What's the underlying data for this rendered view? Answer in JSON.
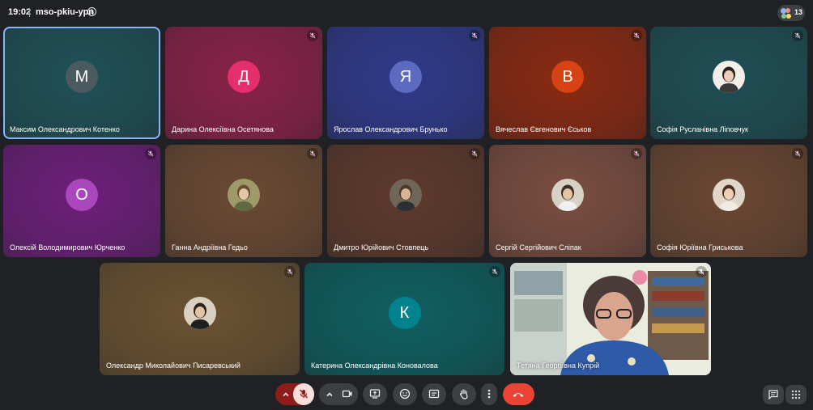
{
  "header": {
    "time": "19:02",
    "meeting_code": "mso-pkiu-ypn",
    "info_icon": "info-icon",
    "participant_count": "13"
  },
  "participants": [
    {
      "name": "Максим Олександрович Котенко",
      "initial": "М",
      "avatar_color": "#4a5a5f",
      "tile_color": "#1f5157",
      "muted": false,
      "active": true
    },
    {
      "name": "Дарина Олексіївна Осетянова",
      "initial": "Д",
      "avatar_color": "#e52f6d",
      "tile_color": "#8a2248",
      "muted": true
    },
    {
      "name": "Ярослав Олександрович Брунько",
      "initial": "Я",
      "avatar_color": "#5c6bc0",
      "tile_color": "#2f3a8a",
      "muted": true
    },
    {
      "name": "Вячеслав Євгенович Єськов",
      "initial": "В",
      "avatar_color": "#d84315",
      "tile_color": "#8a2a12",
      "muted": true
    },
    {
      "name": "Софія Русланівна Ліповчук",
      "initial": "",
      "avatar_color": "#f0ece8",
      "tile_color": "#1f4f55",
      "muted": true,
      "photo": true
    },
    {
      "name": "Олексій Володимирович Юрченко",
      "initial": "О",
      "avatar_color": "#ab47bc",
      "tile_color": "#6d1f7a",
      "muted": true
    },
    {
      "name": "Ганна Андріївна Гедьо",
      "initial": "",
      "avatar_color": "#8e8c5a",
      "tile_color": "#6b4a33",
      "muted": true,
      "photo": true
    },
    {
      "name": "Дмитро Юрійович Стовпець",
      "initial": "",
      "avatar_color": "#5c5040",
      "tile_color": "#5e3a2c",
      "muted": true,
      "photo": true
    },
    {
      "name": "Сергій Сергійович Сліпак",
      "initial": "",
      "avatar_color": "#d9d6cc",
      "tile_color": "#7a4e40",
      "muted": true,
      "photo": true
    },
    {
      "name": "Софія Юріївна Гриськова",
      "initial": "",
      "avatar_color": "#e0d6cb",
      "tile_color": "#6a4732",
      "muted": true,
      "photo": true
    },
    {
      "name": "Олександр Миколайович Писаревський",
      "initial": "",
      "avatar_color": "#d8cfc0",
      "tile_color": "#6b5232",
      "muted": true,
      "photo": true
    },
    {
      "name": "Катерина Олександрівна Коновалова",
      "initial": "К",
      "avatar_color": "#00838f",
      "tile_color": "#0f5f61",
      "muted": true
    },
    {
      "name": "Тетяна Георгіївна Купрій",
      "initial": "",
      "avatar_color": "#c9cdb8",
      "tile_color": "#c9cdb8",
      "muted": true,
      "self_video": true
    }
  ],
  "toolbar": {
    "mic_expand_icon": "chevron-up-icon",
    "mic_icon": "mic-off-icon",
    "cam_expand_icon": "chevron-up-icon",
    "cam_icon": "videocam-icon",
    "present_icon": "present-screen-icon",
    "emoji_icon": "emoji-icon",
    "captions_icon": "captions-icon",
    "raise_hand_icon": "raise-hand-icon",
    "more_icon": "more-vert-icon",
    "leave_icon": "call-end-icon",
    "chat_icon": "chat-icon",
    "activities_icon": "apps-icon"
  },
  "colors": {
    "background": "#202124",
    "active_outline": "#8ab4f8",
    "leave_red": "#ea4335",
    "mic_off_bg": "#f9dedc",
    "mic_off_dark": "#8c1d18"
  }
}
